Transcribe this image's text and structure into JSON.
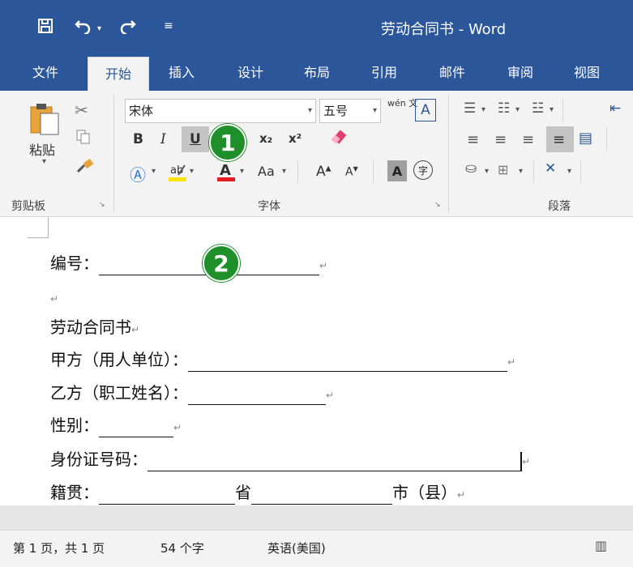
{
  "window": {
    "title": "劳动合同书 - Word"
  },
  "quick_access": {
    "save_icon": "save-icon",
    "undo_icon": "undo-icon",
    "redo_icon": "redo-icon",
    "customize_icon": "customize-qat-icon"
  },
  "tabs": [
    "文件",
    "开始",
    "插入",
    "设计",
    "布局",
    "引用",
    "邮件",
    "审阅",
    "视图"
  ],
  "active_tab": "开始",
  "ribbon": {
    "clipboard": {
      "paste_label": "粘贴",
      "group_label": "剪贴板"
    },
    "font": {
      "font_name": "宋体",
      "font_size": "五号",
      "phonetic": "wén 文",
      "bold": "B",
      "italic": "I",
      "underline": "U",
      "subscript": "x₂",
      "superscript": "x²",
      "font_color": "A",
      "change_case": "Aa",
      "grow": "A",
      "shrink": "A",
      "char_shading": "A",
      "enclose": "字",
      "group_label": "字体"
    },
    "paragraph": {
      "group_label": "段落"
    }
  },
  "callouts": [
    "1",
    "2"
  ],
  "document": {
    "lines": [
      {
        "label": "编号："
      },
      {
        "label": "劳动合同书"
      },
      {
        "label": "甲方（用人单位）："
      },
      {
        "label": "乙方（职工姓名）："
      },
      {
        "label": "性别："
      },
      {
        "label": "身份证号码："
      },
      {
        "label": "籍贯：",
        "mid": "省",
        "end": "市（县）"
      }
    ],
    "paragraph_mark": "↵"
  },
  "status_bar": {
    "page": "第 1 页，共 1 页",
    "words": "54 个字",
    "language": "英语(美国)"
  },
  "colors": {
    "accent": "#2b579a",
    "callout": "#1f8f2a",
    "font_color_bar": "#e51c23",
    "highlight_bar": "#f7e40a"
  }
}
